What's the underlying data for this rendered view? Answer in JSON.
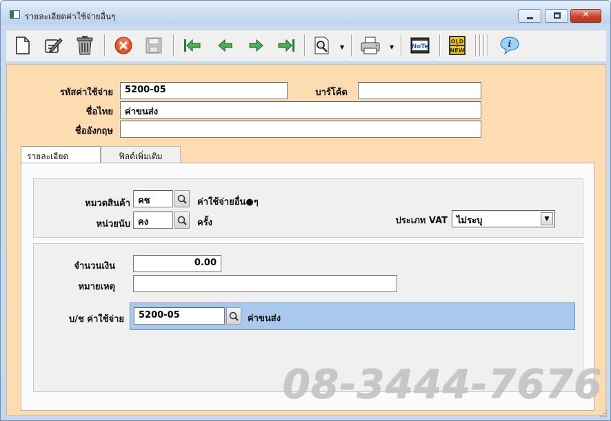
{
  "window": {
    "title": "รายละเอียดค่าใช้จ่ายอื่นๆ",
    "minimize_label": "",
    "maximize_label": "",
    "close_label": "✕"
  },
  "toolbar": {
    "icons": [
      "new-document-icon",
      "edit-icon",
      "delete-trash-icon",
      "cancel-icon",
      "save-icon",
      "first-record-icon",
      "previous-record-icon",
      "next-record-icon",
      "last-record-icon",
      "find-icon",
      "print-icon",
      "note-icon",
      "old-new-icon",
      "info-icon"
    ],
    "note_label": "NoTe",
    "old_label": "OLD",
    "new_label": "NEW"
  },
  "header": {
    "code_label": "รหัสค่าใช้จ่าย",
    "code_value": "5200-05",
    "barcode_label": "บาร์โค้ด",
    "barcode_value": "",
    "thai_name_label": "ชื่อไทย",
    "thai_name_value": "ค่าขนส่ง",
    "english_name_label": "ชื่ออังกฤษ",
    "english_name_value": ""
  },
  "tabs": [
    {
      "label": "รายละเอียด",
      "active": true
    },
    {
      "label": "ฟิลด์เพิ่มเติม",
      "active": false
    }
  ],
  "details": {
    "category_label": "หมวดสินค้า",
    "category_code": "คช",
    "category_name": "ค่าใช้จ่ายอื่น●ๆ",
    "unit_label": "หน่วยนับ",
    "unit_code": "คง",
    "unit_name": "ครั้ง",
    "vat_label": "ประเภท VAT",
    "vat_value": "ไม่ระบุ",
    "amount_label": "จำนวนเงิน",
    "amount_value": "0.00",
    "remark_label": "หมายเหตุ",
    "remark_value": "",
    "account_label": "บ/ช ค่าใช้จ่าย",
    "account_code": "5200-05",
    "account_name": "ค่าขนส่ง"
  },
  "watermark": "08-3444-7676",
  "colors": {
    "content_bg": "#fddcb1",
    "account_bar": "#a8c8ec",
    "close_button": "#c9452b"
  }
}
